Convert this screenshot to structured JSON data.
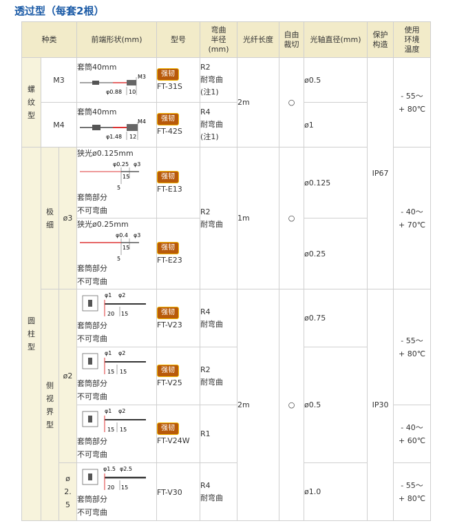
{
  "title": "透过型（每套2根）",
  "headers": {
    "category": "种类",
    "shape": "前端形状(mm)",
    "model": "型号",
    "bend": "弯曲\n半径\n(mm)",
    "length": "光纤长度",
    "cut": "自由\n裁切",
    "diameter": "光轴直径(mm)",
    "protection": "保护\n构造",
    "temp": "使用\n环境\n温度"
  },
  "badge_label": "强韧",
  "groups": {
    "screw": "螺纹型",
    "cylinder": "圆柱型",
    "ultrafine": "极细",
    "sideview": "侧视界型",
    "phi3": "ø3",
    "phi2": "ø2",
    "phi25": "ø2.5"
  },
  "rows": [
    {
      "size": "M3",
      "shape_caption": "套筒40mm",
      "dim1": "M3",
      "dim2": "φ0.88",
      "dim3": "10",
      "model": "FT-31S",
      "bend": "R2\n耐弯曲\n(注1)",
      "diameter": "ø0.5"
    },
    {
      "size": "M4",
      "shape_caption": "套筒40mm",
      "dim1": "M4",
      "dim2": "φ1.48",
      "dim3": "12",
      "model": "FT-42S",
      "bend": "R4\n耐弯曲\n(注1)",
      "diameter": "ø1"
    },
    {
      "shape_caption": "狭光ø0.125mm",
      "dim1": "φ0.25",
      "dim2": "φ3",
      "dim3": "15",
      "dim4": "5",
      "note": "套筒部分\n不可弯曲",
      "model": "FT-E13",
      "diameter": "ø0.125"
    },
    {
      "shape_caption": "狭光ø0.25mm",
      "dim1": "φ0.4",
      "dim2": "φ3",
      "dim3": "15",
      "dim4": "5",
      "note": "套筒部分\n不可弯曲",
      "model": "FT-E23",
      "diameter": "ø0.25"
    },
    {
      "dim1": "φ1",
      "dim2": "φ2",
      "dim3": "20",
      "dim4": "15",
      "note": "套筒部分\n不可弯曲",
      "model": "FT-V23",
      "bend": "R4\n耐弯曲",
      "diameter": "ø0.75",
      "temp": "- 55～\n+ 80℃"
    },
    {
      "dim1": "φ1",
      "dim2": "φ2",
      "dim3": "15",
      "dim4": "15",
      "note": "套筒部分\n不可弯曲",
      "model": "FT-V25",
      "bend": "R2\n耐弯曲",
      "temp": "- 55～\n+ 80℃"
    },
    {
      "dim1": "φ1",
      "dim2": "φ2",
      "dim3": "15",
      "dim4": "15",
      "note": "套筒部分\n不可弯曲",
      "model": "FT-V24W",
      "bend": "R1",
      "temp": "- 40～\n+ 60℃"
    },
    {
      "dim1": "φ1.5",
      "dim2": "φ2.5",
      "dim3": "20",
      "dim4": "15",
      "note": "套筒部分\n不可弯曲",
      "model": "FT-V30",
      "bend": "R4\n耐弯曲",
      "diameter": "ø1.0",
      "temp": "- 55～\n+ 80℃"
    }
  ],
  "merged": {
    "len_2m_a": "2m",
    "len_1m": "1m",
    "len_2m_b": "2m",
    "cut_a": "○",
    "cut_b": "○",
    "cut_c": "○",
    "bend_e": "R2\n耐弯曲",
    "dia_v": "ø0.5",
    "ip67": "IP67",
    "ip30": "IP30",
    "temp_a": "- 55～\n+ 80℃",
    "temp_b": "- 40～\n+ 70℃"
  }
}
